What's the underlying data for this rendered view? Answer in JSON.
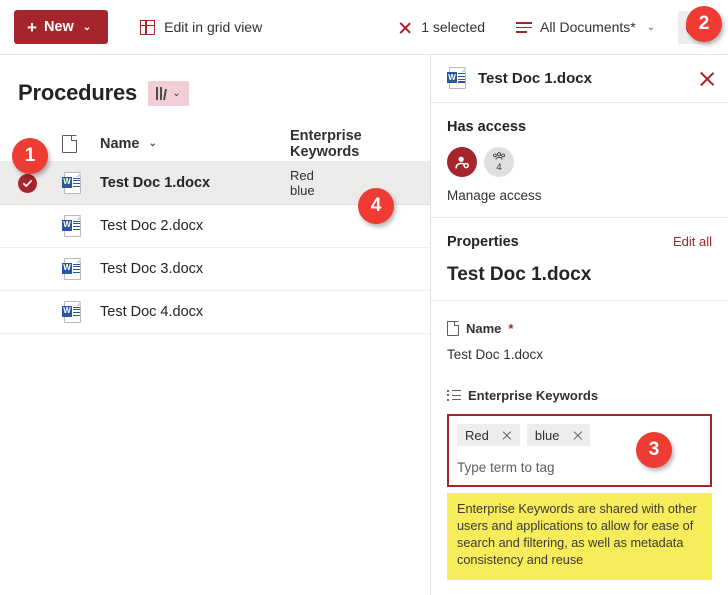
{
  "commandbar": {
    "new_label": "New",
    "new_plus": "+",
    "new_chevron": "⌄",
    "edit_grid_label": "Edit in grid view",
    "selected_label": "1 selected",
    "view_label": "All Documents*",
    "view_chevron": "⌄",
    "info_glyph": "i",
    "accent_red": "#a4262c"
  },
  "library": {
    "title": "Procedures",
    "view_chip_chevron": "⌄",
    "columns": {
      "name": "Name",
      "name_chevron": "⌄",
      "keywords": "Enterprise Keywords"
    },
    "rows": [
      {
        "name": "Test Doc 1.docx",
        "keywords": [
          "Red",
          "blue"
        ],
        "selected": true
      },
      {
        "name": "Test Doc 2.docx",
        "keywords": [],
        "selected": false
      },
      {
        "name": "Test Doc 3.docx",
        "keywords": [],
        "selected": false
      },
      {
        "name": "Test Doc 4.docx",
        "keywords": [],
        "selected": false
      }
    ],
    "word_icon_letter": "W"
  },
  "panel": {
    "header_title": "Test Doc 1.docx",
    "access": {
      "title": "Has access",
      "group_count": "4",
      "manage_link": "Manage access"
    },
    "properties": {
      "title": "Properties",
      "edit_all": "Edit all",
      "file_title": "Test Doc 1.docx",
      "name_field": {
        "label": "Name",
        "required_mark": "*",
        "value": "Test Doc 1.docx"
      },
      "keywords_field": {
        "label": "Enterprise Keywords",
        "chips": [
          "Red",
          "blue"
        ],
        "placeholder": "Type term to tag"
      }
    },
    "tooltip": "Enterprise Keywords are shared with other users and applications to allow for ease of search and filtering, as well as metadata consistency and reuse"
  },
  "callouts": {
    "one": "1",
    "two": "2",
    "three": "3",
    "four": "4",
    "color": "#ee3b33"
  }
}
